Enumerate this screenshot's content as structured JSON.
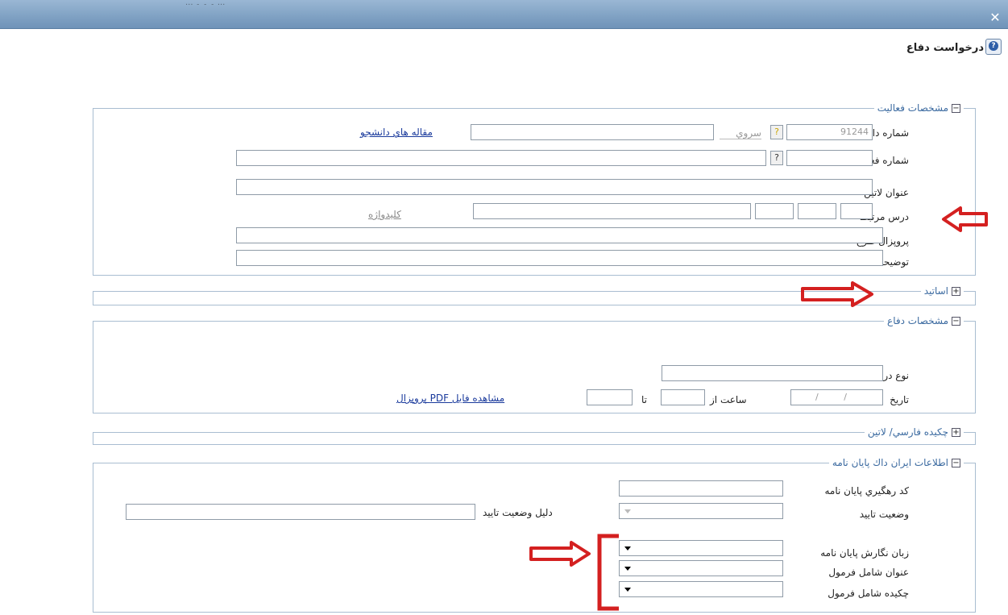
{
  "window": {
    "ghost_title": "... ۔ ۔ ۔  ..."
  },
  "page": {
    "title": "درخواست دفاع"
  },
  "activity": {
    "legend": "مشخصات فعاليت",
    "student_no_label": "شماره دانشجو",
    "student_no_value": "91244",
    "student_name_value": "سروي",
    "articles_link": "مقاله هاي دانشجو",
    "activity_no_label": "شماره فعاليت",
    "latin_title_label": "عنوان لاتين",
    "course_label": "درس مرتبط",
    "keyword_link": "كليدواژه",
    "proposal_label": "پروپزال طرح",
    "notes_label": "توضيحات"
  },
  "professors": {
    "legend": "اساتيد"
  },
  "defense": {
    "legend": "مشخصات دفاع",
    "request_type_label": "نوع درخواست",
    "date_label": "تاريخ",
    "date_value": "/ /",
    "time_from_label": "ساعت از",
    "to_label": "تا",
    "pdf_link": "مشاهده فايل PDF پروپزال"
  },
  "abstract": {
    "legend": "چكيده فارسي/ لاتين"
  },
  "irandoc": {
    "legend": "اطلاعات ايران داك پايان نامه",
    "tracking_code_label": "كد رهگيري پايان نامه",
    "approval_status_label": "وضعيت تاييد",
    "approval_reason_label": "دليل وضعيت تاييد",
    "thesis_language_label": "زبان نگارش پايان نامه",
    "title_formula_label": "عنوان شامل فرمول",
    "abstract_formula_label": "چكيده شامل فرمول"
  },
  "colors": {
    "titlebar": "#7fa1c3",
    "legend_text": "#3b6aa0",
    "link": "#1a3a9c",
    "annotation_red": "#d42020"
  }
}
